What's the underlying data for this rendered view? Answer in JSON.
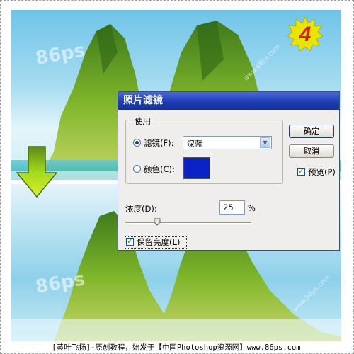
{
  "caption": "[黄叶飞扬]-原创教程，始发于【中国Photoshop资源网】www.86ps.com",
  "badge": {
    "step": "4",
    "icon": "step-number-badge"
  },
  "watermark": {
    "logo": "86ps",
    "url": "www.86ps.com"
  },
  "arrow": {
    "icon": "down-arrow-icon"
  },
  "dialog": {
    "title": "照片滤镜",
    "use_group": "使用",
    "filter_label": "滤镜(F):",
    "filter_value": "深蓝",
    "color_label": "颜色(C):",
    "color_swatch": "#0a21c4",
    "selected_mode": "filter",
    "ok_label": "确定",
    "cancel_label": "取消",
    "preview_label": "预览(P)",
    "preview_checked": true,
    "density_label": "浓度(D):",
    "density_value": "25",
    "density_unit": "%",
    "density_fraction": 0.25,
    "preserve_label": "保留亮度(L)",
    "preserve_checked": true
  },
  "colors": {
    "title_bar": "#1d3db8",
    "badge_fill": "#e9e400",
    "badge_digit": "#e21b12",
    "arrow_fill": "#a3d81c"
  }
}
